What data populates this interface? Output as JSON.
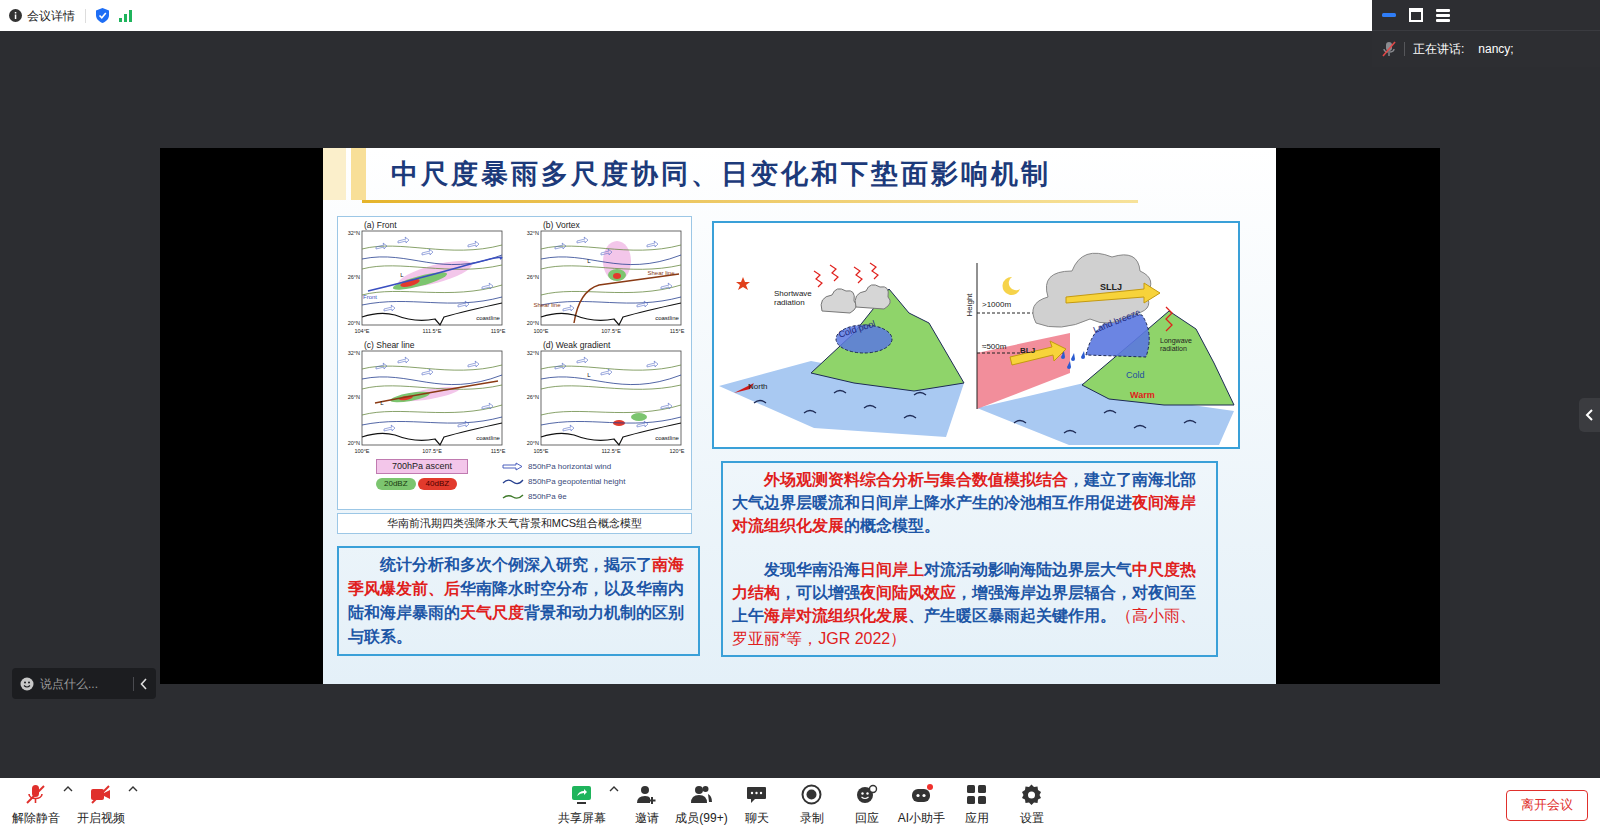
{
  "top_bar": {
    "meeting_info": "会议详情"
  },
  "speaker_panel": {
    "label": "正在讲话:",
    "names": "nancy;"
  },
  "shared_slide": {
    "title": "中尺度暴雨多尺度协同、日变化和下垫面影响机制",
    "figure": {
      "panels": [
        {
          "label": "(a) Front",
          "lat_ticks": [
            "32°N",
            "26°N",
            "20°N"
          ],
          "lon_ticks": [
            "104°E",
            "111.5°E",
            "119°E"
          ],
          "annotations": [
            "Front",
            "L",
            "coastline"
          ]
        },
        {
          "label": "(b) Vortex",
          "lat_ticks": [
            "32°N",
            "26°N",
            "20°N"
          ],
          "lon_ticks": [
            "100°E",
            "107.5°E",
            "115°E"
          ],
          "annotations": [
            "L",
            "Shear line",
            "Shear line",
            "coastline"
          ]
        },
        {
          "label": "(c) Shear line",
          "lat_ticks": [
            "32°N",
            "26°N",
            "20°N"
          ],
          "lon_ticks": [
            "100°E",
            "107.5°E",
            "115°E"
          ],
          "annotations": [
            "L",
            "coastline"
          ]
        },
        {
          "label": "(d) Weak gradient",
          "lat_ticks": [
            "32°N",
            "26°N",
            "20°N"
          ],
          "lon_ticks": [
            "105°E",
            "112.5°E",
            "120°E"
          ],
          "annotations": [
            "L",
            "coastline"
          ]
        }
      ],
      "legend": [
        {
          "kind": "ascent",
          "label": "700hPa ascent"
        },
        {
          "kind": "radar20",
          "label": "20dBZ"
        },
        {
          "kind": "radar40",
          "label": "40dBZ"
        },
        {
          "kind": "wind",
          "label": "850hPa horizontal wind"
        },
        {
          "kind": "height",
          "label": "850hPa geopotential height"
        },
        {
          "kind": "theta",
          "label": "850hPa θe"
        }
      ],
      "caption": "华南前汛期四类强降水天气背景和MCS组合概念模型"
    },
    "diagram": {
      "labels": [
        "Shortwave radiation",
        "Cold pool",
        "North",
        "Height",
        ">1000m",
        "≈500m",
        "SLLJ",
        "BLJ",
        "Land breeze",
        "Longwave radiation",
        "Cold",
        "Warm"
      ]
    },
    "left_text": {
      "segments": [
        {
          "text": "统计分析和多次个例深入研究，揭示了",
          "kind": "plain"
        },
        {
          "text": "南海季风爆发前、后",
          "kind": "emphasis"
        },
        {
          "text": "华南降水时空分布，以及华南内陆和海岸暴雨的",
          "kind": "plain"
        },
        {
          "text": "天气尺度",
          "kind": "emphasis"
        },
        {
          "text": "背景和动力机制的区别与联系。",
          "kind": "plain"
        }
      ]
    },
    "right_text": {
      "paragraphs": [
        {
          "segments": [
            {
              "text": "外场观测资料综合分析与集合数值模拟结合",
              "kind": "emphasis"
            },
            {
              "text": "，建立了南海北部大气边界层暖流和日间岸上降水产生的冷池相互作用促进",
              "kind": "plain"
            },
            {
              "text": "夜间海岸对流组织化发展",
              "kind": "emphasis"
            },
            {
              "text": "的概念模型。",
              "kind": "plain"
            }
          ]
        },
        {
          "segments": [
            {
              "text": "发现华南沿海",
              "kind": "plain"
            },
            {
              "text": "日间岸上",
              "kind": "emphasis"
            },
            {
              "text": "对流活动影响海陆边界层大气",
              "kind": "plain"
            },
            {
              "text": "中尺度热力结构",
              "kind": "emphasis"
            },
            {
              "text": "，可以增强",
              "kind": "plain"
            },
            {
              "text": "夜间陆风效应",
              "kind": "emphasis"
            },
            {
              "text": "，增强海岸边界层辐合，对夜间至上午",
              "kind": "plain"
            },
            {
              "text": "海岸对流组织化发展",
              "kind": "emphasis"
            },
            {
              "text": "、产生暖区暴雨起关键作用。",
              "kind": "plain"
            },
            {
              "text": "（高小雨、罗亚丽*等，JGR 2022）",
              "kind": "citation"
            }
          ]
        }
      ]
    }
  },
  "chat": {
    "placeholder": "说点什么..."
  },
  "toolbar": {
    "left": [
      {
        "kind": "mic",
        "label": "解除静音",
        "has_menu": true,
        "off": true
      },
      {
        "kind": "video",
        "label": "开启视频",
        "has_menu": true,
        "off": true
      }
    ],
    "center": [
      {
        "kind": "share",
        "label": "共享屏幕",
        "has_menu": true,
        "badge_dot": false
      },
      {
        "kind": "invite",
        "label": "邀请",
        "has_menu": false,
        "badge_dot": false
      },
      {
        "kind": "members",
        "label": "成员(99+)",
        "has_menu": false,
        "badge_dot": false
      },
      {
        "kind": "chat",
        "label": "聊天",
        "has_menu": false,
        "badge_dot": false
      },
      {
        "kind": "record",
        "label": "录制",
        "has_menu": false,
        "badge_dot": false
      },
      {
        "kind": "react",
        "label": "回应",
        "has_menu": false,
        "badge_dot": false
      },
      {
        "kind": "ai",
        "label": "AI小助手",
        "has_menu": false,
        "badge_dot": true
      },
      {
        "kind": "apps",
        "label": "应用",
        "has_menu": false,
        "badge_dot": false
      },
      {
        "kind": "settings",
        "label": "设置",
        "has_menu": false,
        "badge_dot": false
      }
    ],
    "leave": "离开会议"
  }
}
